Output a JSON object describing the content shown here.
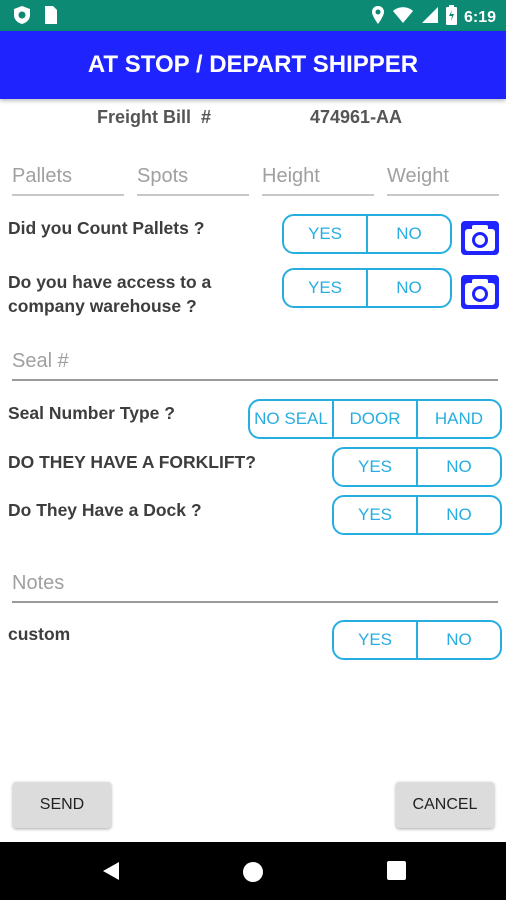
{
  "status_bar": {
    "time": "6:19"
  },
  "header": {
    "title": "AT STOP / DEPART SHIPPER"
  },
  "freight_bill": {
    "label": "Freight Bill  #",
    "value": "474961-AA"
  },
  "fields": {
    "pallets": {
      "placeholder": "Pallets"
    },
    "spots": {
      "placeholder": "Spots"
    },
    "height": {
      "placeholder": "Height"
    },
    "weight": {
      "placeholder": "Weight"
    },
    "seal": {
      "placeholder": "Seal #"
    },
    "notes": {
      "placeholder": "Notes"
    }
  },
  "questions": {
    "count_pallets": {
      "label": "Did you Count Pallets ?",
      "yes": "YES",
      "no": "NO"
    },
    "warehouse": {
      "label": "Do you have access to a company warehouse ?",
      "yes": "YES",
      "no": "NO"
    },
    "seal_type": {
      "label": "Seal Number Type ?",
      "options": [
        "NO SEAL",
        "DOOR",
        "HAND"
      ]
    },
    "forklift": {
      "label": "DO THEY HAVE A FORKLIFT?",
      "yes": "YES",
      "no": "NO"
    },
    "dock": {
      "label": "Do They Have a Dock ?",
      "yes": "YES",
      "no": "NO"
    },
    "custom": {
      "label": "custom",
      "yes": "YES",
      "no": "NO"
    }
  },
  "actions": {
    "send": "SEND",
    "cancel": "CANCEL"
  },
  "colors": {
    "accent": "#27aee0",
    "app_bar": "#1f24ff",
    "status_bar": "#0c8a73",
    "camera": "#1f24ff"
  },
  "icons": [
    "shield-icon",
    "sim-icon",
    "location-icon",
    "wifi-icon",
    "signal-icon",
    "battery-icon",
    "camera-icon",
    "back-icon",
    "home-icon",
    "recents-icon"
  ]
}
